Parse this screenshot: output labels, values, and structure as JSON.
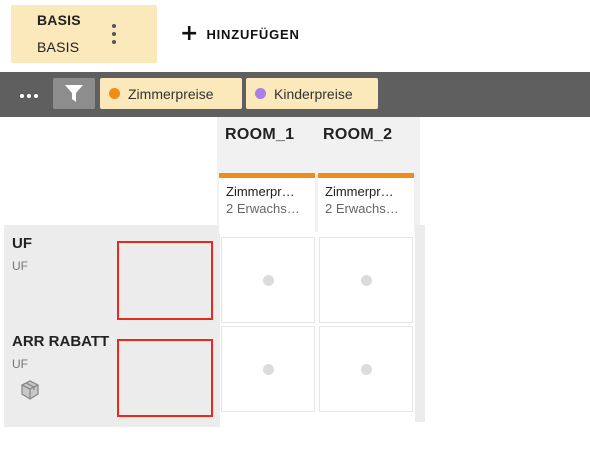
{
  "header": {
    "basis_title": "BASIS",
    "basis_subtitle": "BASIS",
    "add_label": "HINZUFÜGEN",
    "add_symbol": "+"
  },
  "filter_bar": {
    "tags": [
      {
        "label": "Zimmerpreise",
        "color": "#f28c18"
      },
      {
        "label": "Kinderpreise",
        "color": "#a97fe0"
      }
    ]
  },
  "columns": [
    {
      "title": "ROOM_1",
      "line1": "Zimmerpr…",
      "line2": "2 Erwachs…",
      "accent": "#f28c18"
    },
    {
      "title": "ROOM_2",
      "line1": "Zimmerpr…",
      "line2": "2 Erwachs…",
      "accent": "#f28c18"
    }
  ],
  "rows": [
    {
      "title": "UF",
      "subtitle": "UF"
    },
    {
      "title": "ARR RABATT",
      "subtitle": "UF",
      "icon": "package-icon"
    }
  ],
  "colors": {
    "chip_bg": "#fbe8bb",
    "bar_bg": "#5f5f5f",
    "highlight_border": "#e8291c"
  }
}
